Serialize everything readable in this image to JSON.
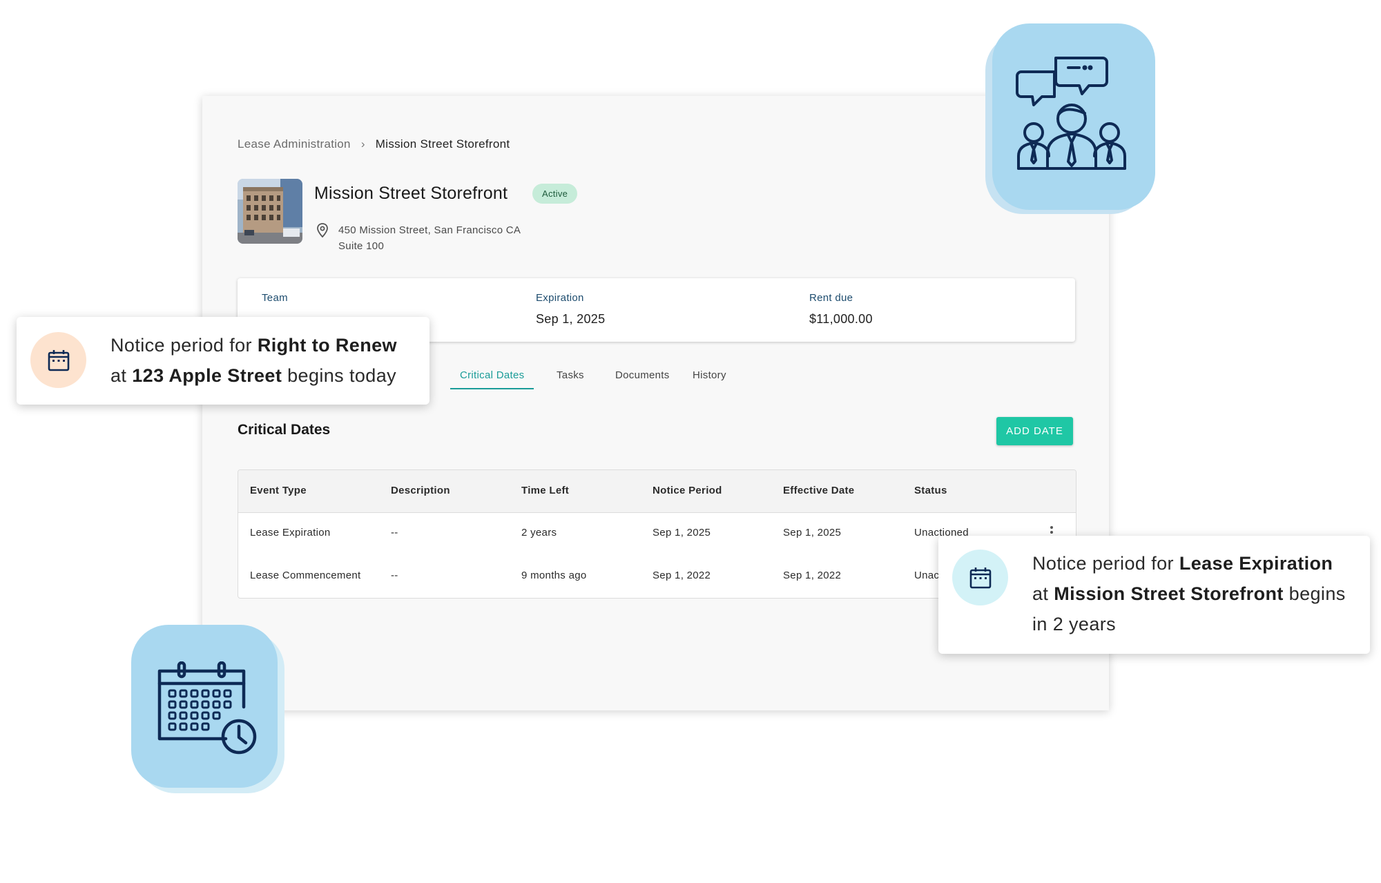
{
  "breadcrumb": {
    "parent": "Lease Administration",
    "separator": "›",
    "current": "Mission Street Storefront"
  },
  "property": {
    "title": "Mission Street Storefront",
    "status": "Active",
    "address_line1": "450 Mission Street, San Francisco CA",
    "address_line2": "Suite 100",
    "location_icon": "location-pin-icon"
  },
  "summary": {
    "team_label": "Team",
    "expiration_label": "Expiration",
    "expiration_value": "Sep 1, 2025",
    "rent_label": "Rent due",
    "rent_value": "$11,000.00"
  },
  "tabs": {
    "critical_dates": "Critical Dates",
    "tasks": "Tasks",
    "documents": "Documents",
    "history": "History",
    "active": "Critical Dates"
  },
  "section": {
    "title": "Critical Dates",
    "add_button": "ADD DATE"
  },
  "table": {
    "headers": [
      "Event Type",
      "Description",
      "Time Left",
      "Notice Period",
      "Effective Date",
      "Status"
    ],
    "rows": [
      [
        "Lease Expiration",
        "--",
        "2 years",
        "Sep 1, 2025",
        "Sep 1, 2025",
        "Unactioned"
      ],
      [
        "Lease Commencement",
        "--",
        "9 months ago",
        "Sep 1, 2022",
        "Sep 1, 2022",
        "Unac"
      ]
    ]
  },
  "toast_left": {
    "icon": "calendar-icon",
    "prefix": "Notice period for ",
    "bold1": "Right to Renew",
    "mid": "at ",
    "bold2": "123 Apple Street",
    "suffix": " begins today"
  },
  "toast_right": {
    "icon": "calendar-icon",
    "prefix": "Notice period for ",
    "bold1": "Lease Expiration",
    "mid": "at ",
    "bold2": "Mission Street Storefront",
    "suffix": " begins",
    "line3": "in 2 years"
  },
  "colors": {
    "accent_teal": "#1a9c98",
    "button_green": "#1fc7a5",
    "badge_bg": "#c6ecd9",
    "tile_blue": "#a9d8f0",
    "icon_navy": "#0e2a55"
  },
  "decor": {
    "top_tile_icon": "team-chat-icon",
    "bottom_tile_icon": "calendar-clock-icon"
  }
}
